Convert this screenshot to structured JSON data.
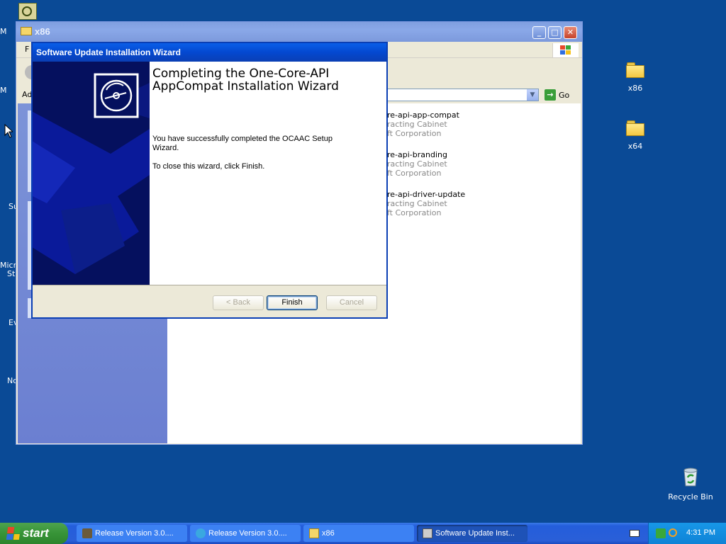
{
  "desktop": {
    "icons": [
      {
        "label": "x86"
      },
      {
        "label": "x64"
      },
      {
        "label": "Recycle Bin"
      }
    ],
    "left_cutoff_labels": [
      "M",
      "M",
      "Su",
      "Micro",
      "Stu",
      "Ev",
      "No"
    ]
  },
  "explorer": {
    "title": "x86",
    "menu_first_letter": "F",
    "address_label": "Ad",
    "go_label": "Go",
    "files": [
      {
        "name": "re-api-app-compat",
        "type": "racting Cabinet",
        "company": "ft Corporation"
      },
      {
        "name": "re-api-branding",
        "type": "racting Cabinet",
        "company": "ft Corporation"
      },
      {
        "name": "re-api-driver-update",
        "type": "racting Cabinet",
        "company": "ft Corporation"
      }
    ]
  },
  "wizard": {
    "title": "Software Update Installation Wizard",
    "heading": "Completing the One-Core-API AppCompat Installation Wizard",
    "message": "You have successfully completed the OCAAC Setup Wizard.",
    "instruction": "To close this wizard, click Finish.",
    "back_label": "< Back",
    "finish_label": "Finish",
    "cancel_label": "Cancel"
  },
  "taskbar": {
    "start_label": "start",
    "tasks": [
      {
        "label": "Release Version 3.0...."
      },
      {
        "label": "Release Version 3.0...."
      },
      {
        "label": "x86"
      },
      {
        "label": "Software Update Inst..."
      }
    ],
    "clock": "4:31 PM"
  }
}
